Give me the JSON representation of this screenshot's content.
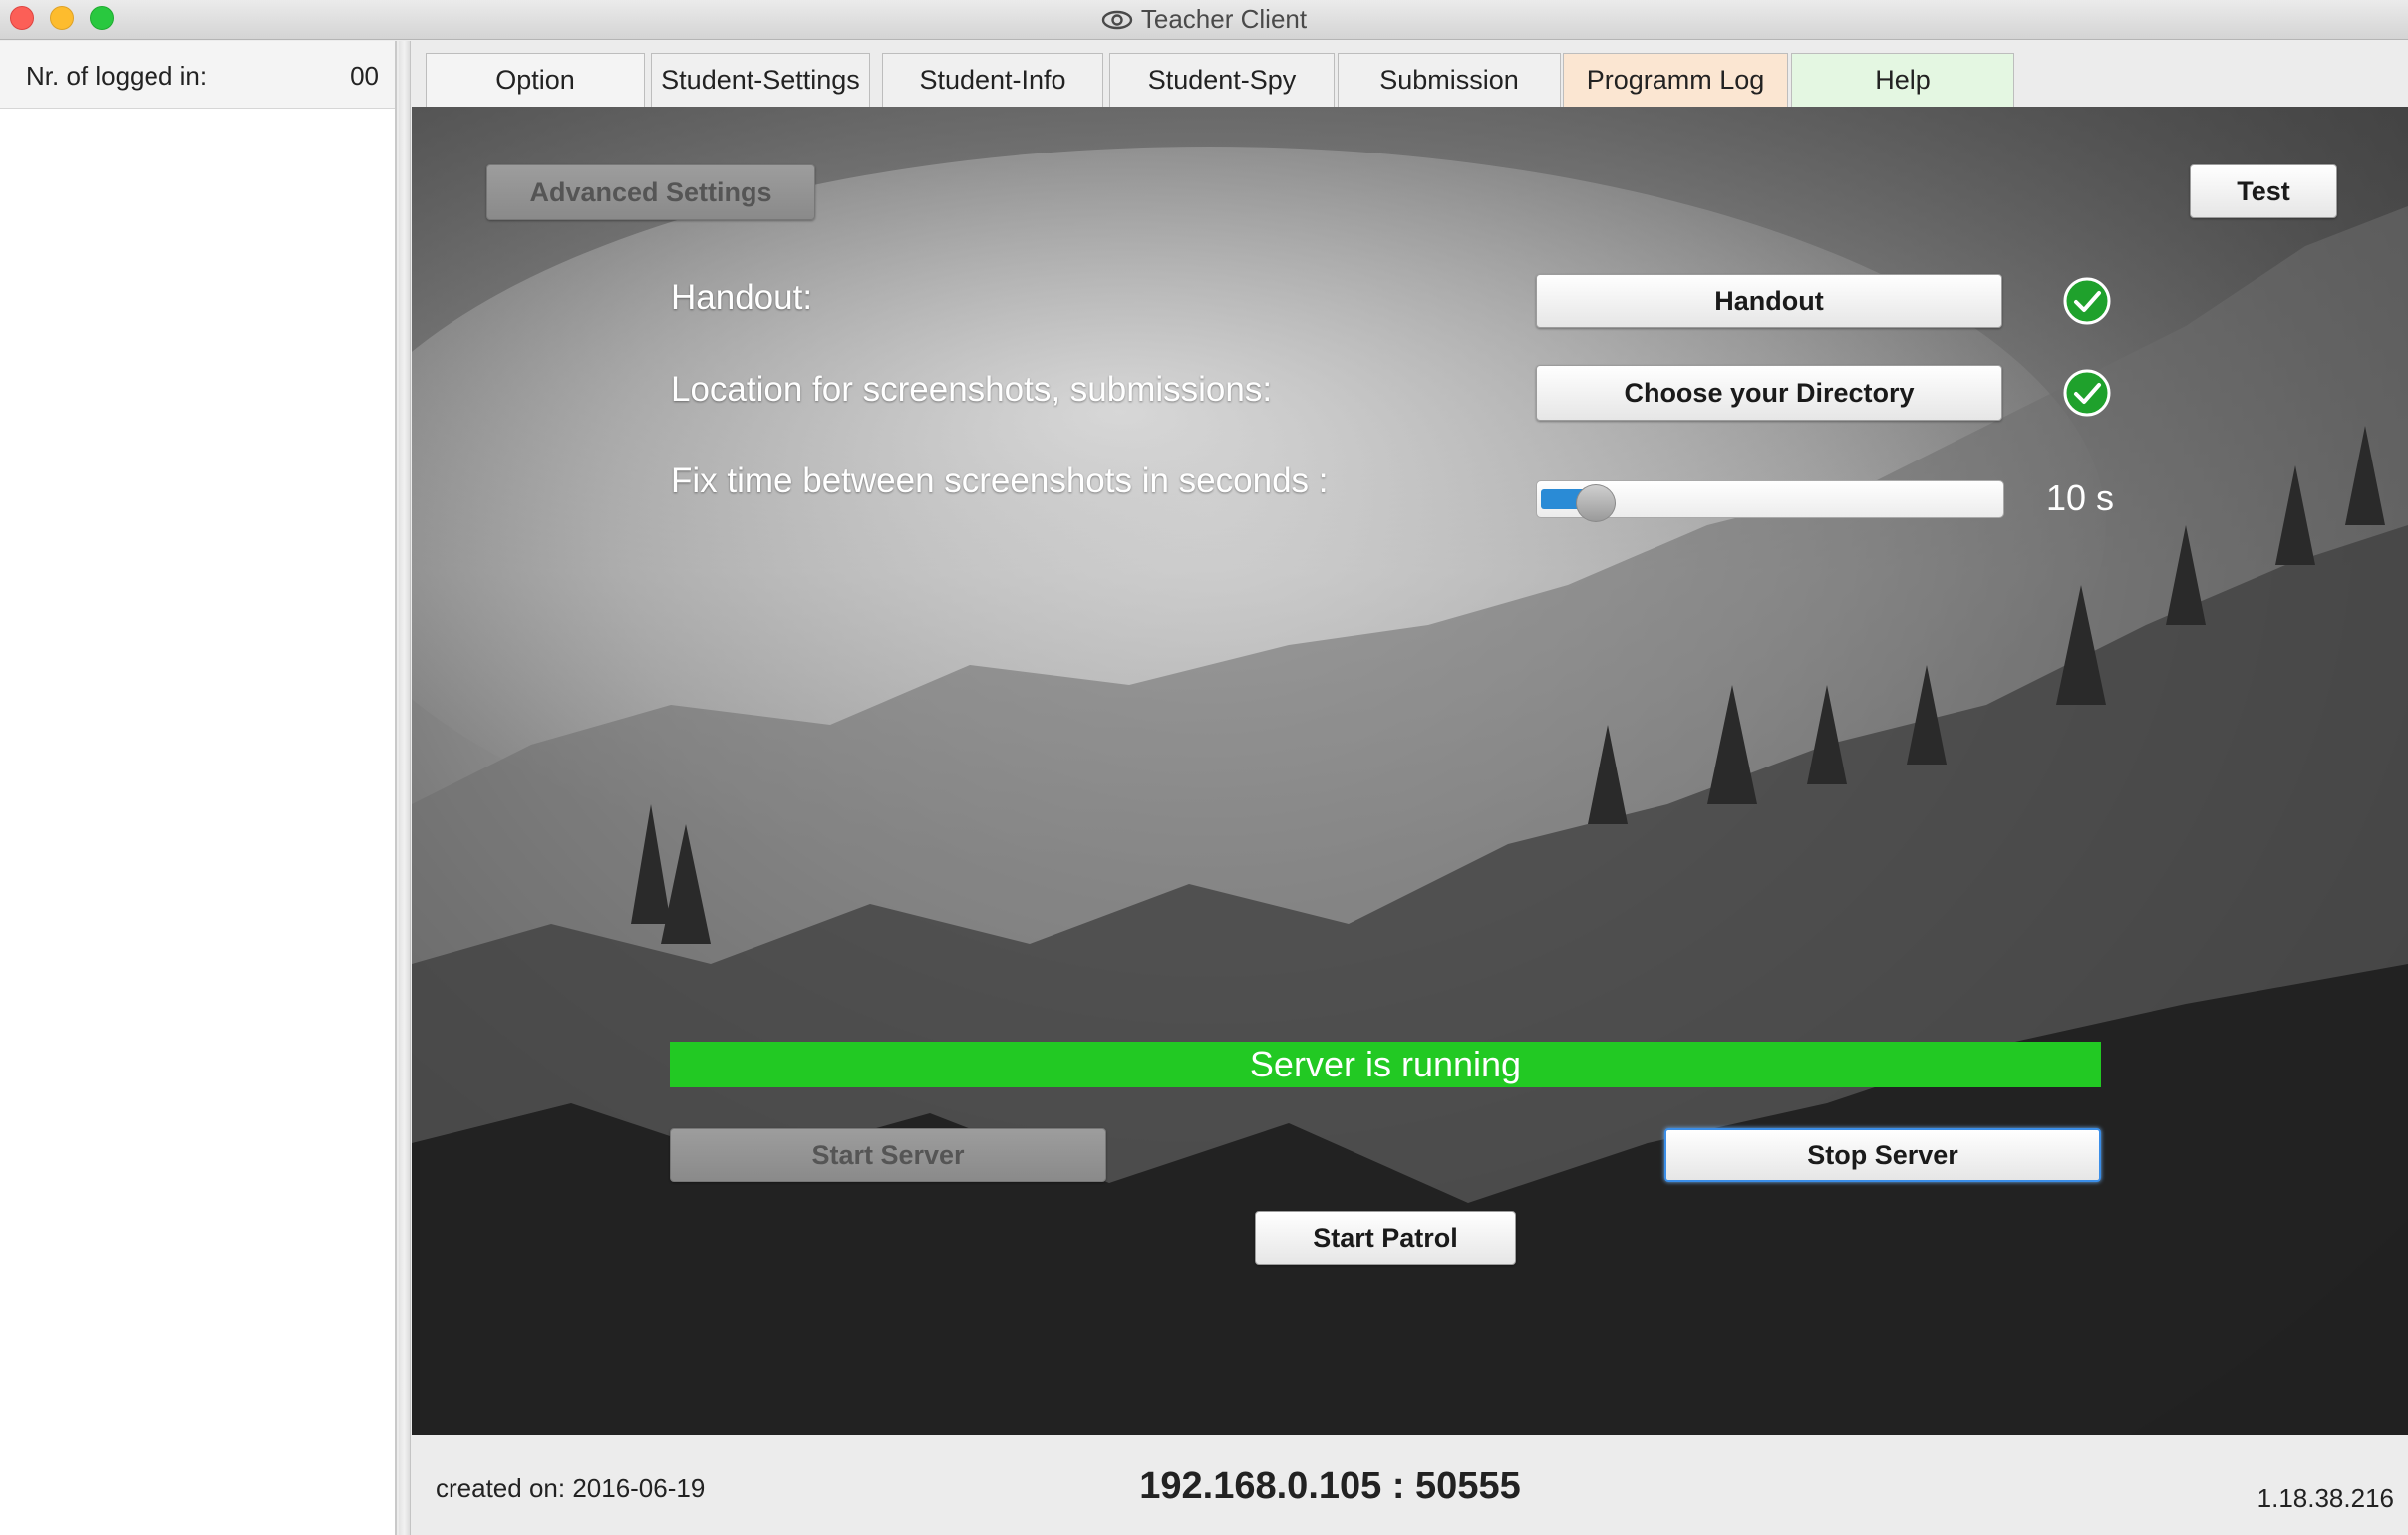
{
  "window": {
    "title": "Teacher Client"
  },
  "sidebar": {
    "logged_label": "Nr. of logged in:",
    "logged_count": "00"
  },
  "tabs": [
    {
      "label": "Option",
      "color": "#f4f4f4"
    },
    {
      "label": "Student-Settings",
      "color": "#f0f0f0"
    },
    {
      "label": "Student-Info",
      "color": "#f0f0f0"
    },
    {
      "label": "Student-Spy",
      "color": "#f0f0f0"
    },
    {
      "label": "Submission",
      "color": "#f0f0f0"
    },
    {
      "label": "Programm Log",
      "color": "#fbe6d2"
    },
    {
      "label": "Help",
      "color": "#e4f7e2"
    }
  ],
  "main": {
    "advanced_settings": "Advanced Settings",
    "test": "Test",
    "handout_label": "Handout:",
    "handout_button": "Handout",
    "location_label": "Location for screenshots, submissions:",
    "directory_button": "Choose your Directory",
    "screenshot_interval_label": "Fix time between screenshots in seconds :",
    "screenshot_interval_value": "10 s",
    "slider_fraction": 0.12,
    "status_text": "Server is running",
    "status_color": "#22c923",
    "start_server": "Start Server",
    "stop_server": "Stop Server",
    "start_patrol": "Start Patrol"
  },
  "footer": {
    "created": "created on: 2016-06-19",
    "address": "192.168.0.105 : 50555",
    "version": "1.18.38.216"
  }
}
